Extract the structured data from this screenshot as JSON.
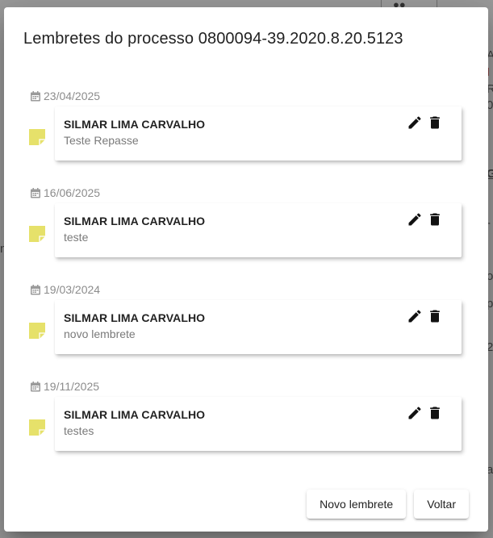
{
  "modal": {
    "title": "Lembretes do processo 0800094-39.2020.8.20.5123",
    "reminders": [
      {
        "date": "23/04/2025",
        "author": "SILMAR LIMA CARVALHO",
        "text": "Teste Repasse"
      },
      {
        "date": "16/06/2025",
        "author": "SILMAR LIMA CARVALHO",
        "text": "teste"
      },
      {
        "date": "19/03/2024",
        "author": "SILMAR LIMA CARVALHO",
        "text": "novo lembrete"
      },
      {
        "date": "19/11/2025",
        "author": "SILMAR LIMA CARVALHO",
        "text": "testes"
      }
    ],
    "actions": {
      "new_reminder_label": "Novo lembrete",
      "back_label": "Voltar"
    }
  },
  "colors": {
    "note_icon": "#e6e16a",
    "date_text": "#8c8c8c",
    "overlay": "#8a8a8a"
  },
  "icons": {
    "date": "calendar-icon",
    "note": "sticky-note-icon",
    "edit": "pencil-icon",
    "delete": "trash-icon"
  }
}
